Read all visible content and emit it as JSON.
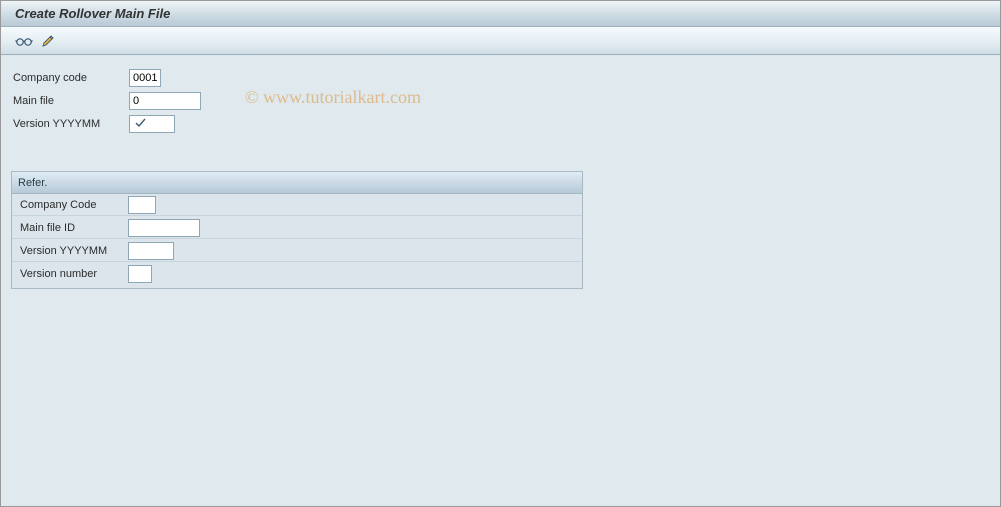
{
  "title": "Create Rollover Main File",
  "watermark": "© www.tutorialkart.com",
  "fields": {
    "company_code": {
      "label": "Company code",
      "value": "0001"
    },
    "main_file": {
      "label": "Main file",
      "value": "0"
    },
    "version": {
      "label": "Version YYYYMM",
      "value": ""
    }
  },
  "group": {
    "title": "Refer.",
    "fields": {
      "company_code": {
        "label": "Company Code",
        "value": ""
      },
      "main_file_id": {
        "label": "Main file ID",
        "value": ""
      },
      "version": {
        "label": "Version YYYYMM",
        "value": ""
      },
      "version_number": {
        "label": "Version number",
        "value": ""
      }
    }
  }
}
